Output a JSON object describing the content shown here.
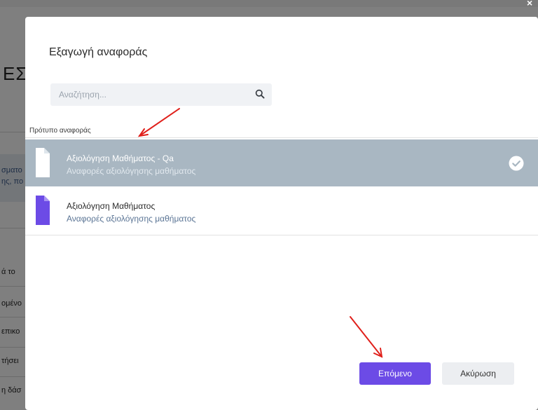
{
  "background": {
    "heading": "ΕΣ",
    "card_lines": [
      "σματο",
      "ης, πο"
    ],
    "list_items": [
      "ά το",
      "ομένο",
      "επικο",
      "τήσει",
      "η δάσ"
    ]
  },
  "modal": {
    "title": "Εξαγωγή αναφοράς",
    "search": {
      "placeholder": "Αναζήτηση..."
    },
    "section_label": "Πρότυπο αναφοράς",
    "templates": [
      {
        "title": "Αξιολόγηση Μαθήματος - Qa",
        "subtitle": "Αναφορές αξιολόγησης μαθήματος",
        "selected": true,
        "icon": "document-icon",
        "icon_color": "#ffffff"
      },
      {
        "title": "Αξιολόγηση Μαθήματος",
        "subtitle": "Αναφορές αξιολόγησης μαθήματος",
        "selected": false,
        "icon": "document-icon",
        "icon_color": "#6c4be6"
      }
    ],
    "buttons": {
      "next": "Επόμενο",
      "cancel": "Ακύρωση"
    }
  },
  "colors": {
    "accent": "#6c4be6",
    "selected_row": "#a9b7c2",
    "annotation_arrow": "#e0201b"
  }
}
